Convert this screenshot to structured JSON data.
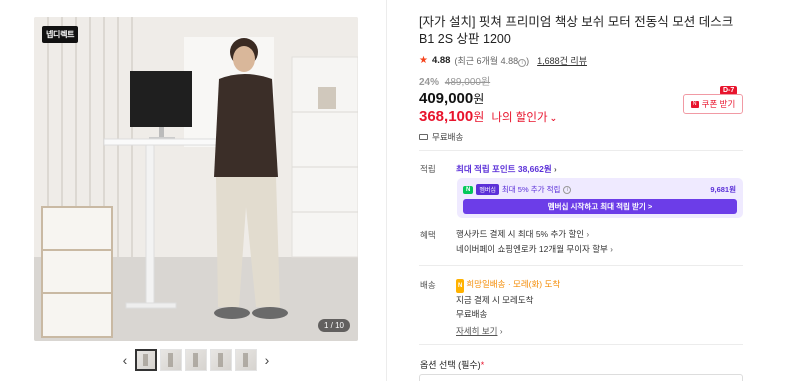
{
  "gallery": {
    "brand_logo": "넵디렉트",
    "counter": "1 / 10",
    "prev_label": "‹",
    "next_label": "›"
  },
  "product": {
    "title": "[자가 설치] 핏쳐 프리미엄 책상 보쉬 모터 전동식 모션 데스크 B1 2S 상판 1200",
    "rating": "4.88",
    "rating_note": "(최근 6개월 4.88",
    "review_count": "1,688건 리뷰",
    "discount_rate": "24%",
    "original_price": "489,000원",
    "price": "409,000",
    "price_unit": "원",
    "my_price": "368,100",
    "my_price_unit": "원",
    "my_price_label": "나의 할인가",
    "shipping": "무료배송"
  },
  "coupon": {
    "label": "쿠폰 받기",
    "dday": "D-7"
  },
  "points": {
    "label": "적립",
    "max_points_text": "최대 적립 포인트",
    "max_points_value": "38,662원",
    "membership_badge": "N",
    "membership_name": "멤버십",
    "membership_text": "최대 5% 추가 적립",
    "membership_points": "9,681원",
    "membership_button": "멤버십 시작하고 최대 적립 받기 >"
  },
  "benefits": {
    "label": "혜택",
    "line1": "행사카드 결제 시 최대 5% 추가 할인",
    "line2": "네이버페이 쇼핑엔로카 12개월 무이자 할부"
  },
  "delivery": {
    "label": "배송",
    "badge": "N",
    "type": "희망일배송",
    "arrival": "· 모레(화) 도착",
    "line2": "지금 결제 시 모레도착",
    "line3": "무료배송",
    "detail_link": "자세히 보기"
  },
  "options": {
    "title": "옵션 선택 (필수)"
  },
  "colors": {
    "accent_red": "#e8142d",
    "membership_purple": "#6c3de8",
    "star": "#f5441e"
  }
}
